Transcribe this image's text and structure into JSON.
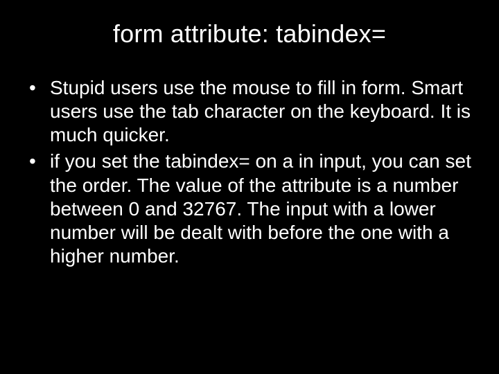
{
  "title": "form attribute: tabindex=",
  "bullets": [
    "Stupid users use the mouse to fill in form. Smart users use the tab character on the keyboard. It is much quicker.",
    "if you set the tabindex= on a in input, you can set the order. The value of the attribute is a number between 0 and 32767. The input with a lower number will be dealt with before the one with a higher number."
  ]
}
